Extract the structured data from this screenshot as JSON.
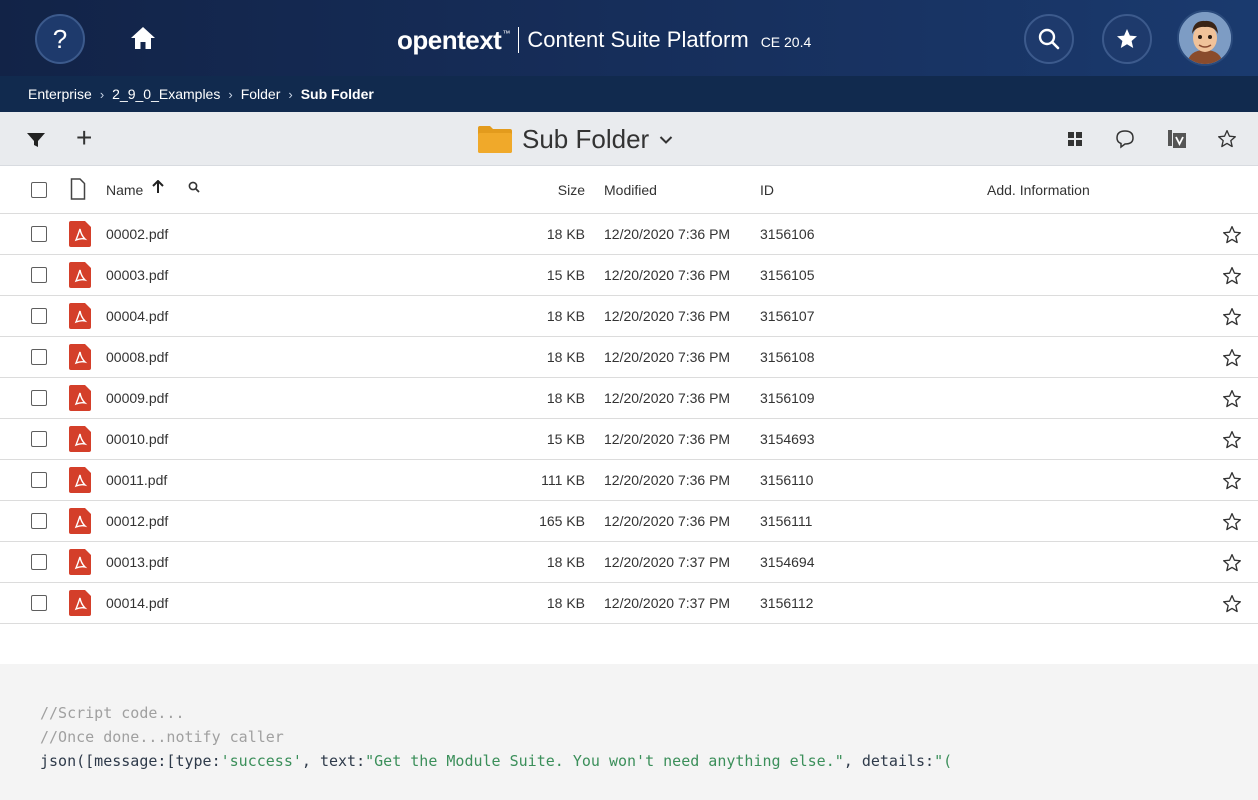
{
  "header": {
    "help_label": "?",
    "brand_logo": "opentext",
    "brand_tm": "™",
    "product_name": "Content Suite Platform",
    "version": "CE 20.4",
    "bg_color": "#14284f"
  },
  "breadcrumb": {
    "items": [
      "Enterprise",
      "2_9_0_Examples",
      "Folder"
    ],
    "current": "Sub Folder",
    "separator": "›"
  },
  "toolbar": {
    "add_label": "+",
    "folder_name": "Sub Folder",
    "folder_color": "#e39b1d",
    "icons": [
      "filter-icon",
      "add-icon",
      "tiles-view-icon",
      "comment-icon",
      "versions-icon",
      "favorite-star-icon"
    ]
  },
  "table": {
    "headers": {
      "name": "Name",
      "size": "Size",
      "modified": "Modified",
      "id": "ID",
      "add_info": "Add. Information"
    },
    "sort": "ascending",
    "rows": [
      {
        "name": "00002.pdf",
        "size": "18 KB",
        "modified": "12/20/2020 7:36 PM",
        "id": "3156106"
      },
      {
        "name": "00003.pdf",
        "size": "15 KB",
        "modified": "12/20/2020 7:36 PM",
        "id": "3156105"
      },
      {
        "name": "00004.pdf",
        "size": "18 KB",
        "modified": "12/20/2020 7:36 PM",
        "id": "3156107"
      },
      {
        "name": "00008.pdf",
        "size": "18 KB",
        "modified": "12/20/2020 7:36 PM",
        "id": "3156108"
      },
      {
        "name": "00009.pdf",
        "size": "18 KB",
        "modified": "12/20/2020 7:36 PM",
        "id": "3156109"
      },
      {
        "name": "00010.pdf",
        "size": "15 KB",
        "modified": "12/20/2020 7:36 PM",
        "id": "3154693"
      },
      {
        "name": "00011.pdf",
        "size": "111 KB",
        "modified": "12/20/2020 7:36 PM",
        "id": "3156110"
      },
      {
        "name": "00012.pdf",
        "size": "165 KB",
        "modified": "12/20/2020 7:36 PM",
        "id": "3156111"
      },
      {
        "name": "00013.pdf",
        "size": "18 KB",
        "modified": "12/20/2020 7:37 PM",
        "id": "3154694"
      },
      {
        "name": "00014.pdf",
        "size": "18 KB",
        "modified": "12/20/2020 7:37 PM",
        "id": "3156112"
      }
    ]
  },
  "code": {
    "line1": "//Script code...",
    "line2": "//Once done...notify caller",
    "line3_plain1": "json([message:[type:",
    "line3_str1": "'success'",
    "line3_plain2": ", text:",
    "line3_str2": "\"Get the Module Suite. You won't need anything else.\"",
    "line3_plain3": ", details:",
    "line3_str3": "\"("
  }
}
